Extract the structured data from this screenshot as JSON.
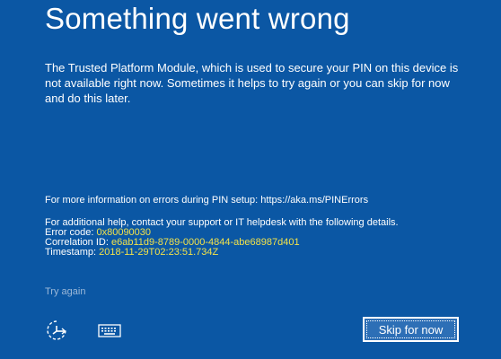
{
  "error_screen": {
    "title": "Something went wrong",
    "message": "The Trusted Platform Module, which is used to secure your PIN on this device is not available right now. Sometimes it helps to try again or you can skip for now and do this later.",
    "more_info": "For more information on errors during PIN setup: https://aka.ms/PINErrors",
    "help_text": "For additional help, contact your support or IT helpdesk with the following details.",
    "error_code_label": "Error code: ",
    "error_code": "0x80090030",
    "correlation_label": "Correlation ID: ",
    "correlation_id": "e6ab11d9-8789-0000-4844-abe68987d401",
    "timestamp_label": "Timestamp: ",
    "timestamp": "2018-11-29T02:23:51.734Z"
  },
  "actions": {
    "try_again": "Try again",
    "skip": "Skip for now"
  },
  "bottom_icons": {
    "accessibility": "ease-of-access-icon",
    "keyboard": "keyboard-icon"
  },
  "colors": {
    "background": "#0b57a4",
    "value_highlight": "#f2e24a",
    "link": "#9cb8d8"
  }
}
